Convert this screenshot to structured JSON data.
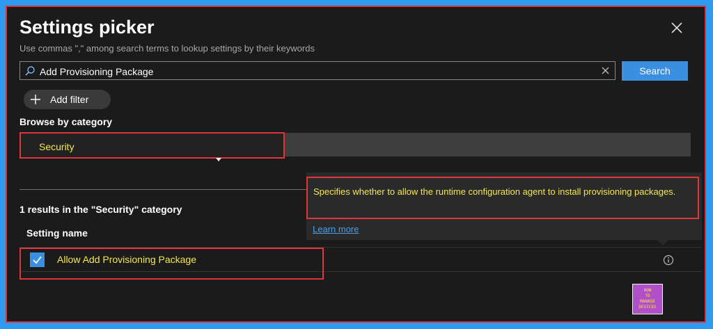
{
  "dialog": {
    "title": "Settings picker",
    "subtitle": "Use commas \",\" among search terms to lookup settings by their keywords",
    "close_icon": "close-icon"
  },
  "search": {
    "value": "Add Provisioning Package",
    "button_label": "Search",
    "icon": "search-icon"
  },
  "filter": {
    "add_filter_label": "Add filter"
  },
  "browse": {
    "label": "Browse by category",
    "selected_category": "Security"
  },
  "results": {
    "summary": "1 results in the \"Security\" category",
    "column_header": "Setting name",
    "rows": [
      {
        "name": "Allow Add Provisioning Package",
        "checked": true
      }
    ]
  },
  "tooltip": {
    "description": "Specifies whether to allow the runtime configuration agent to install provisioning packages.",
    "link": "Learn more"
  },
  "logo": {
    "lines": [
      "HOW",
      "TO",
      "MANAGE",
      "DEVICES"
    ]
  },
  "colors": {
    "accent": "#3b8fe0",
    "highlight_border": "#e0353b",
    "highlight_text": "#f5e84b",
    "background": "#1b1b1b"
  }
}
